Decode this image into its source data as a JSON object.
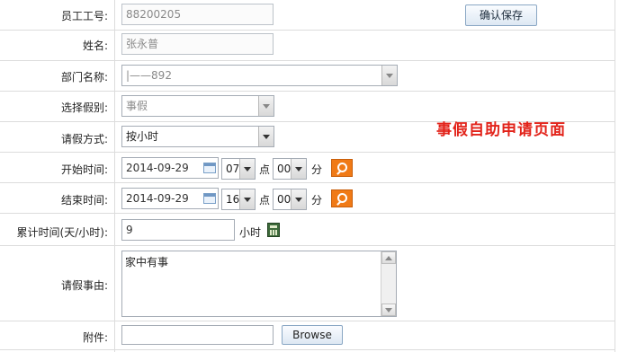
{
  "form": {
    "employee_id": {
      "label": "员工工号:",
      "value": "88200205"
    },
    "name": {
      "label": "姓名:",
      "value": "张永普"
    },
    "department": {
      "label": "部门名称:",
      "value": "|——892"
    },
    "leave_type": {
      "label": "选择假别:",
      "value": "事假"
    },
    "leave_mode": {
      "label": "请假方式:",
      "value": "按小时"
    },
    "start": {
      "label": "开始时间:",
      "date": "2014-09-29",
      "hour": "07",
      "minute": "00",
      "hour_unit": "点",
      "minute_unit": "分"
    },
    "end": {
      "label": "结束时间:",
      "date": "2014-09-29",
      "hour": "16",
      "minute": "00",
      "hour_unit": "点",
      "minute_unit": "分"
    },
    "total": {
      "label": "累计时间(天/小时):",
      "value": "9",
      "unit": "小时"
    },
    "reason": {
      "label": "请假事由:",
      "value": "家中有事"
    },
    "attachment": {
      "label": "附件:",
      "value": "",
      "browse_label": "Browse"
    }
  },
  "toolbar": {
    "save_label": "确认保存"
  },
  "headline": "事假自助申请页面",
  "colors": {
    "headline": "#e2231a",
    "search_button": "#f07a16"
  },
  "icons": [
    "calendar-icon",
    "search-icon",
    "calculator-icon"
  ]
}
